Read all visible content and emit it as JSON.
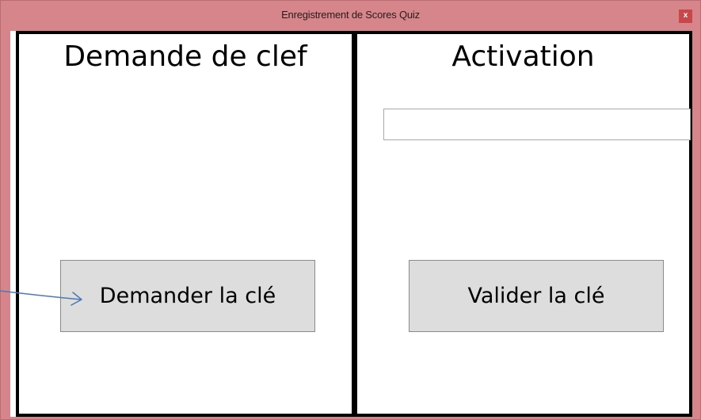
{
  "window": {
    "title": "Enregistrement de Scores Quiz",
    "close_label": "x",
    "colors": {
      "frame": "#d6868b",
      "close_button": "#c7474a",
      "panel_border": "#000000",
      "button_face": "#dddddd",
      "annotation_arrow": "#4a7ab5"
    }
  },
  "left_panel": {
    "title": "Demande de clef",
    "button_label": "Demander la clé"
  },
  "right_panel": {
    "title": "Activation",
    "key_input": {
      "value": "",
      "placeholder": ""
    },
    "button_label": "Valider la clé"
  },
  "annotation": {
    "icon": "arrow-right-icon"
  }
}
